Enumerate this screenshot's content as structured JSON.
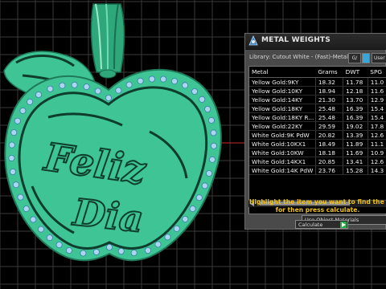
{
  "panel": {
    "title": "METAL WEIGHTS",
    "library_label": "Library: Cutout White - (Fast)-Metal",
    "gv_label": "G/",
    "user_label": "User",
    "columns": [
      "Metal",
      "Grams",
      "DWT",
      "SPG"
    ],
    "rows": [
      [
        "Yellow Gold:9KY",
        "18.32",
        "11.78",
        "11.0"
      ],
      [
        "Yellow Gold:10KY",
        "18.94",
        "12.18",
        "11.6"
      ],
      [
        "Yellow Gold:14KY",
        "21.30",
        "13.70",
        "12.9"
      ],
      [
        "Yellow Gold:18KY",
        "25.48",
        "16.39",
        "15.4"
      ],
      [
        "Yellow Gold:18KY R...",
        "25.48",
        "16.39",
        "15.4"
      ],
      [
        "Yellow Gold:22KY",
        "29.59",
        "19.02",
        "17.8"
      ],
      [
        "White Gold:9K PdW",
        "20.82",
        "13.39",
        "12.6"
      ],
      [
        "White Gold:10KX1",
        "18.49",
        "11.89",
        "11.1"
      ],
      [
        "White Gold:10KW",
        "18.18",
        "11.69",
        "10.9"
      ],
      [
        "White Gold:14KX1",
        "20.85",
        "13.41",
        "12.6"
      ],
      [
        "White Gold:14K PdW",
        "23.76",
        "15.28",
        "14.3"
      ]
    ],
    "use_object_materials": "Use Object Materials",
    "hint_line1": "Highlight the item you want to find the weight",
    "hint_line2": "for then press calculate.",
    "calculate_label": "Calculate"
  },
  "model": {
    "text_line1": "Feliz",
    "text_line2": "Dia",
    "color": "#3ec495"
  },
  "colors": {
    "background": "#000000",
    "grid": "#3c3c3c",
    "model": "#3ec495",
    "model_edge": "#1f7a5a",
    "stone": "#a9d5ef",
    "hint_text": "#f0c419"
  }
}
